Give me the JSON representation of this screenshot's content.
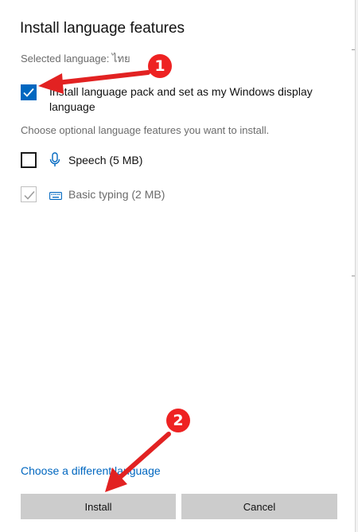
{
  "dialog": {
    "title": "Install language features",
    "selected_language_label": "Selected language: ไทย",
    "language_pack": {
      "label": "Install language pack and set as my Windows display language",
      "checked": true
    },
    "optional_heading": "Choose optional language features you want to install.",
    "features": [
      {
        "label": "Speech (5 MB)",
        "checked": false,
        "enabled": true,
        "icon": "microphone-icon"
      },
      {
        "label": "Basic typing (2 MB)",
        "checked": true,
        "enabled": false,
        "icon": "keyboard-icon"
      }
    ],
    "change_link": "Choose a different language",
    "buttons": {
      "install": "Install",
      "cancel": "Cancel"
    }
  },
  "annotations": [
    {
      "number": "1",
      "color": "#e22222"
    },
    {
      "number": "2",
      "color": "#e22222"
    }
  ]
}
